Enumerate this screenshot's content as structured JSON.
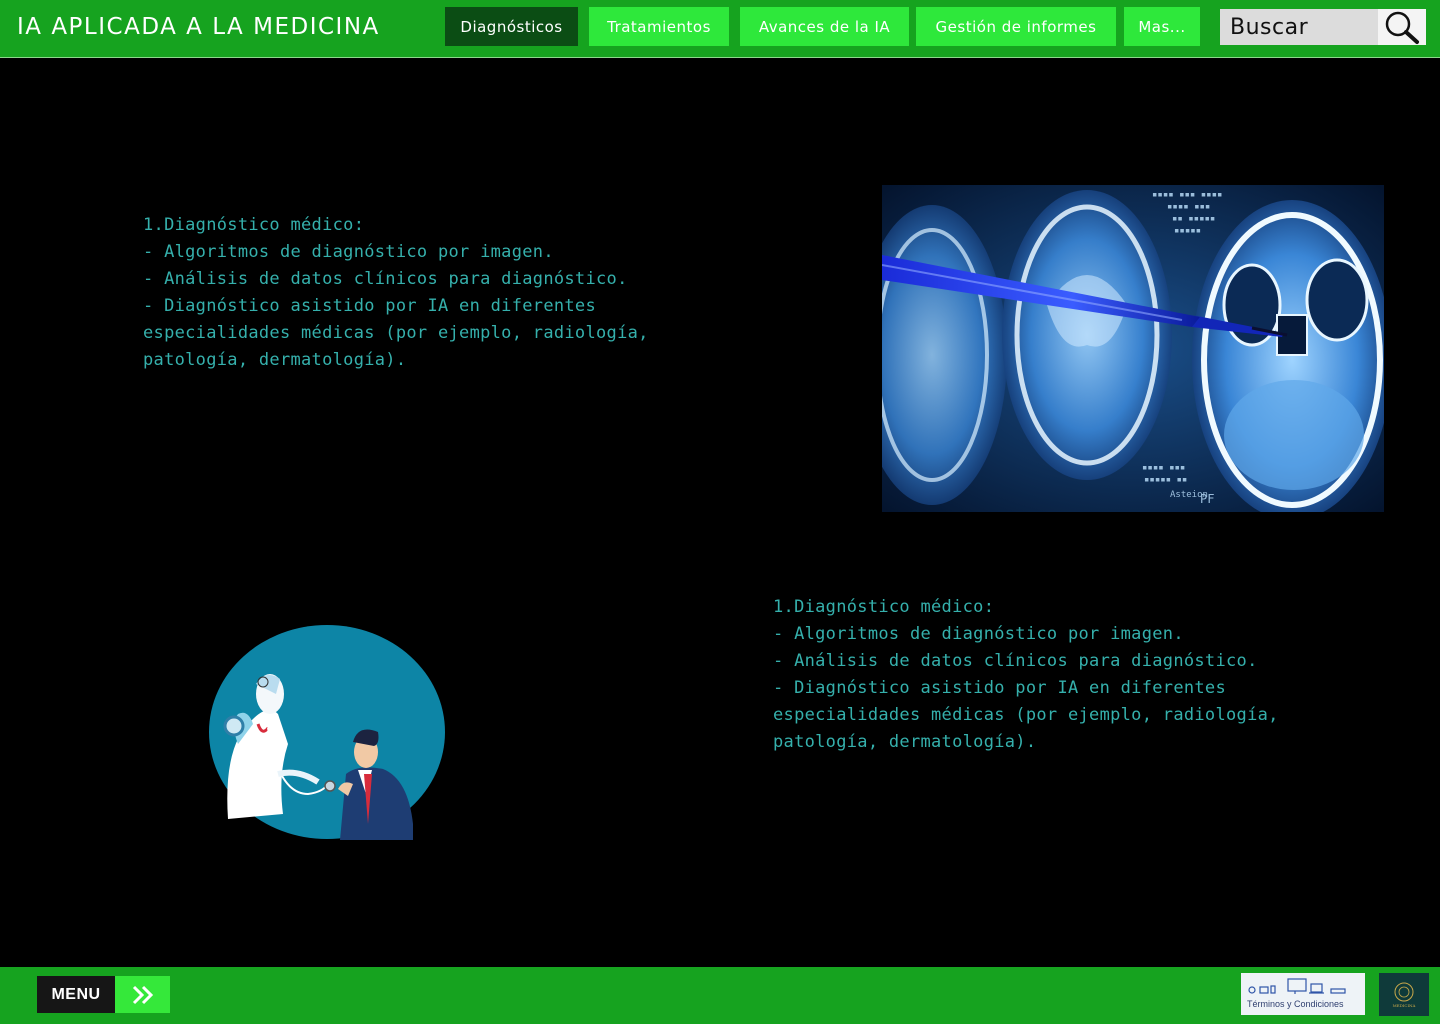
{
  "header": {
    "title": "IA APLICADA A LA MEDICINA",
    "nav": [
      {
        "label": "Diagnósticos",
        "active": true
      },
      {
        "label": "Tratamientos",
        "active": false
      },
      {
        "label": "Avances de la IA",
        "active": false
      },
      {
        "label": "Gestión de informes",
        "active": false
      },
      {
        "label": "Mas...",
        "active": false
      }
    ],
    "search": {
      "placeholder": "Buscar"
    }
  },
  "main": {
    "block1": "1.Diagnóstico médico:\n- Algoritmos de diagnóstico por imagen.\n- Análisis de datos clínicos para diagnóstico.\n - Diagnóstico asistido por IA en diferentes especialidades médicas (por ejemplo, radiología, patología, dermatología).",
    "block2": "1.Diagnóstico médico:\n- Algoritmos de diagnóstico por imagen.\n- Análisis de datos clínicos para diagnóstico.\n - Diagnóstico asistido por IA en diferentes especialidades médicas (por ejemplo, radiología, patología, dermatología).",
    "mri_labels": [
      "PF",
      "Asteion"
    ]
  },
  "footer": {
    "menu_label": "MENU",
    "terms_label": "Términos y Condiciones",
    "seal_text": "MEDICINA"
  },
  "colors": {
    "bar_green": "#16a31f",
    "button_green": "#2ee83b",
    "active_green": "#0b4d14",
    "text_teal": "#35b0ac"
  }
}
